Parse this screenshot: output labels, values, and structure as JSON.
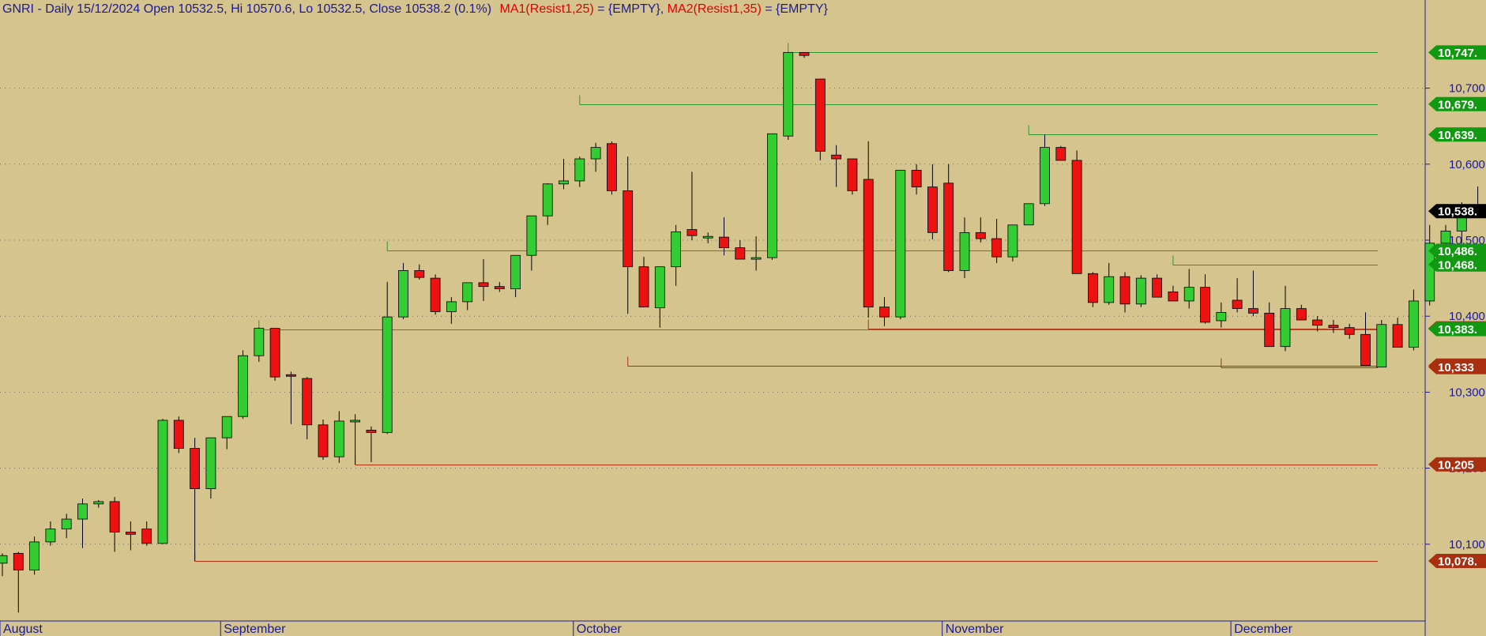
{
  "header": {
    "prefix": "GNRI - Daily 15/12/2024 Open 10532.5, Hi 10570.6, Lo 10532.5, Close 10538.2 (0.1%)",
    "ma1": "MA1(Resist1,25)",
    "ma1_value": " = {EMPTY}, ",
    "ma2": "MA2(Resist1,35)",
    "ma2_value": " = {EMPTY}"
  },
  "colors": {
    "background": "#d5c48d",
    "up": "#33cc33",
    "down": "#ee1111",
    "wick": "#000000",
    "support_line": "#b03010",
    "resist_line": "#2a9a2a",
    "axis": "#1a1a9a",
    "tag_green": "#119911",
    "tag_red": "#a82f10",
    "tag_last": "#000000"
  },
  "chart_data": {
    "type": "candlestick",
    "symbol": "GNRI",
    "interval": "Daily",
    "ylim": [
      10000,
      10790
    ],
    "y_ticks": [
      "10,100",
      "10,200",
      "10,300",
      "10,400",
      "10,500",
      "10,600",
      "10,700"
    ],
    "y_tick_values": [
      10100,
      10200,
      10300,
      10400,
      10500,
      10600,
      10700
    ],
    "months": [
      {
        "label": "August",
        "bar": 0
      },
      {
        "label": "September",
        "bar": 14
      },
      {
        "label": "October",
        "bar": 36
      },
      {
        "label": "November",
        "bar": 59
      },
      {
        "label": "December",
        "bar": 77
      }
    ],
    "ohlc": [
      [
        10075,
        10088,
        10058,
        10085
      ],
      [
        10088,
        10090,
        10010,
        10066
      ],
      [
        10066,
        10110,
        10060,
        10103
      ],
      [
        10103,
        10130,
        10098,
        10120
      ],
      [
        10120,
        10140,
        10108,
        10133
      ],
      [
        10133,
        10160,
        10095,
        10153
      ],
      [
        10153,
        10158,
        10148,
        10156
      ],
      [
        10156,
        10162,
        10090,
        10116
      ],
      [
        10116,
        10130,
        10092,
        10113
      ],
      [
        10120,
        10130,
        10098,
        10101
      ],
      [
        10101,
        10265,
        10100,
        10263
      ],
      [
        10263,
        10268,
        10220,
        10226
      ],
      [
        10226,
        10240,
        10078,
        10173
      ],
      [
        10173,
        10240,
        10160,
        10240
      ],
      [
        10240,
        10250,
        10225,
        10268
      ],
      [
        10268,
        10355,
        10265,
        10348
      ],
      [
        10348,
        10385,
        10340,
        10384
      ],
      [
        10384,
        10384,
        10315,
        10320
      ],
      [
        10323,
        10327,
        10258,
        10322
      ],
      [
        10318,
        10320,
        10238,
        10257
      ],
      [
        10257,
        10264,
        10211,
        10215
      ],
      [
        10215,
        10275,
        10207,
        10262
      ],
      [
        10262,
        10271,
        10205,
        10263
      ],
      [
        10250,
        10255,
        10208,
        10247
      ],
      [
        10247,
        10445,
        10245,
        10399
      ],
      [
        10399,
        10470,
        10396,
        10460
      ],
      [
        10460,
        10468,
        10448,
        10451
      ],
      [
        10450,
        10455,
        10402,
        10406
      ],
      [
        10406,
        10425,
        10390,
        10419
      ],
      [
        10419,
        10430,
        10408,
        10444
      ],
      [
        10444,
        10475,
        10420,
        10439
      ],
      [
        10439,
        10445,
        10432,
        10436
      ],
      [
        10436,
        10478,
        10425,
        10480
      ],
      [
        10480,
        10520,
        10460,
        10532
      ],
      [
        10532,
        10575,
        10520,
        10574
      ],
      [
        10574,
        10607,
        10567,
        10578
      ],
      [
        10578,
        10610,
        10570,
        10607
      ],
      [
        10607,
        10628,
        10590,
        10622
      ],
      [
        10627,
        10630,
        10560,
        10565
      ],
      [
        10565,
        10610,
        10403,
        10465
      ],
      [
        10465,
        10478,
        10420,
        10412
      ],
      [
        10411,
        10445,
        10385,
        10465
      ],
      [
        10465,
        10520,
        10440,
        10511
      ],
      [
        10514,
        10590,
        10500,
        10506
      ],
      [
        10504,
        10510,
        10496,
        10505
      ],
      [
        10504,
        10530,
        10480,
        10490
      ],
      [
        10490,
        10500,
        10475,
        10475
      ],
      [
        10475,
        10505,
        10460,
        10477
      ],
      [
        10477,
        10640,
        10474,
        10640
      ],
      [
        10637,
        10747,
        10632,
        10747
      ],
      [
        10747,
        10747,
        10740,
        10743
      ],
      [
        10712,
        10712,
        10605,
        10617
      ],
      [
        10612,
        10625,
        10570,
        10607
      ],
      [
        10607,
        10607,
        10560,
        10565
      ],
      [
        10580,
        10630,
        10398,
        10412
      ],
      [
        10412,
        10425,
        10387,
        10399
      ],
      [
        10399,
        10592,
        10396,
        10592
      ],
      [
        10592,
        10600,
        10560,
        10570
      ],
      [
        10570,
        10600,
        10501,
        10510
      ],
      [
        10575,
        10600,
        10458,
        10460
      ],
      [
        10460,
        10530,
        10450,
        10510
      ],
      [
        10510,
        10530,
        10497,
        10502
      ],
      [
        10502,
        10528,
        10470,
        10478
      ],
      [
        10478,
        10520,
        10472,
        10520
      ],
      [
        10520,
        10548,
        10530,
        10548
      ],
      [
        10548,
        10639,
        10545,
        10622
      ],
      [
        10622,
        10624,
        10607,
        10605
      ],
      [
        10605,
        10618,
        10460,
        10456
      ],
      [
        10456,
        10458,
        10412,
        10418
      ],
      [
        10418,
        10470,
        10415,
        10452
      ],
      [
        10452,
        10458,
        10405,
        10416
      ],
      [
        10416,
        10454,
        10412,
        10450
      ],
      [
        10450,
        10455,
        10430,
        10425
      ],
      [
        10432,
        10440,
        10420,
        10420
      ],
      [
        10420,
        10462,
        10410,
        10438
      ],
      [
        10438,
        10455,
        10390,
        10392
      ],
      [
        10394,
        10418,
        10385,
        10405
      ],
      [
        10421,
        10450,
        10405,
        10410
      ],
      [
        10410,
        10460,
        10400,
        10404
      ],
      [
        10404,
        10418,
        10380,
        10360
      ],
      [
        10360,
        10440,
        10354,
        10410
      ],
      [
        10410,
        10415,
        10395,
        10395
      ],
      [
        10395,
        10400,
        10380,
        10388
      ],
      [
        10388,
        10395,
        10378,
        10385
      ],
      [
        10385,
        10390,
        10370,
        10376
      ],
      [
        10376,
        10405,
        10370,
        10335
      ],
      [
        10333,
        10395,
        10333,
        10389
      ],
      [
        10389,
        10398,
        10370,
        10359
      ],
      [
        10359,
        10435,
        10355,
        10420
      ],
      [
        10420,
        10520,
        10414,
        10496
      ],
      [
        10496,
        10520,
        10480,
        10512
      ],
      [
        10512,
        10550,
        10479,
        10531
      ],
      [
        10532.5,
        10570.6,
        10532.5,
        10538.2
      ]
    ],
    "horizontal_levels": [
      {
        "value": 10747,
        "kind": "resist",
        "from_bar": 49
      },
      {
        "value": 10679,
        "kind": "resist",
        "from_bar": 36
      },
      {
        "value": 10639,
        "kind": "resist",
        "from_bar": 64
      },
      {
        "value": 10486,
        "kind": "resist",
        "from_bar": 24
      },
      {
        "value": 10468,
        "kind": "resist",
        "from_bar": 73
      },
      {
        "value": 10384,
        "kind": "support",
        "from_bar": 54
      },
      {
        "value": 10383,
        "kind": "resist",
        "from_bar": 16
      },
      {
        "value": 10335,
        "kind": "support",
        "from_bar": 39
      },
      {
        "value": 10333,
        "kind": "support",
        "from_bar": 76
      },
      {
        "value": 10205,
        "kind": "support",
        "from_bar": 22
      },
      {
        "value": 10078,
        "kind": "support",
        "from_bar": 12
      }
    ],
    "price_tags": [
      {
        "label": "10,747.",
        "value": 10747,
        "color": "green"
      },
      {
        "label": "10,679.",
        "value": 10679,
        "color": "green"
      },
      {
        "label": "10,639.",
        "value": 10639,
        "color": "green"
      },
      {
        "label": "10,538.",
        "value": 10538.2,
        "color": "last"
      },
      {
        "label": "10,486.",
        "value": 10486,
        "color": "green"
      },
      {
        "label": "10,468.",
        "value": 10468,
        "color": "green"
      },
      {
        "label": "10,384",
        "value": 10384,
        "color": "red"
      },
      {
        "label": "10,383.",
        "value": 10383,
        "color": "green"
      },
      {
        "label": "10,335.",
        "value": 10335,
        "color": "red"
      },
      {
        "label": "10,333",
        "value": 10333,
        "color": "red"
      },
      {
        "label": "10,205",
        "value": 10205,
        "color": "red"
      },
      {
        "label": "10,078.",
        "value": 10078,
        "color": "red"
      }
    ]
  }
}
